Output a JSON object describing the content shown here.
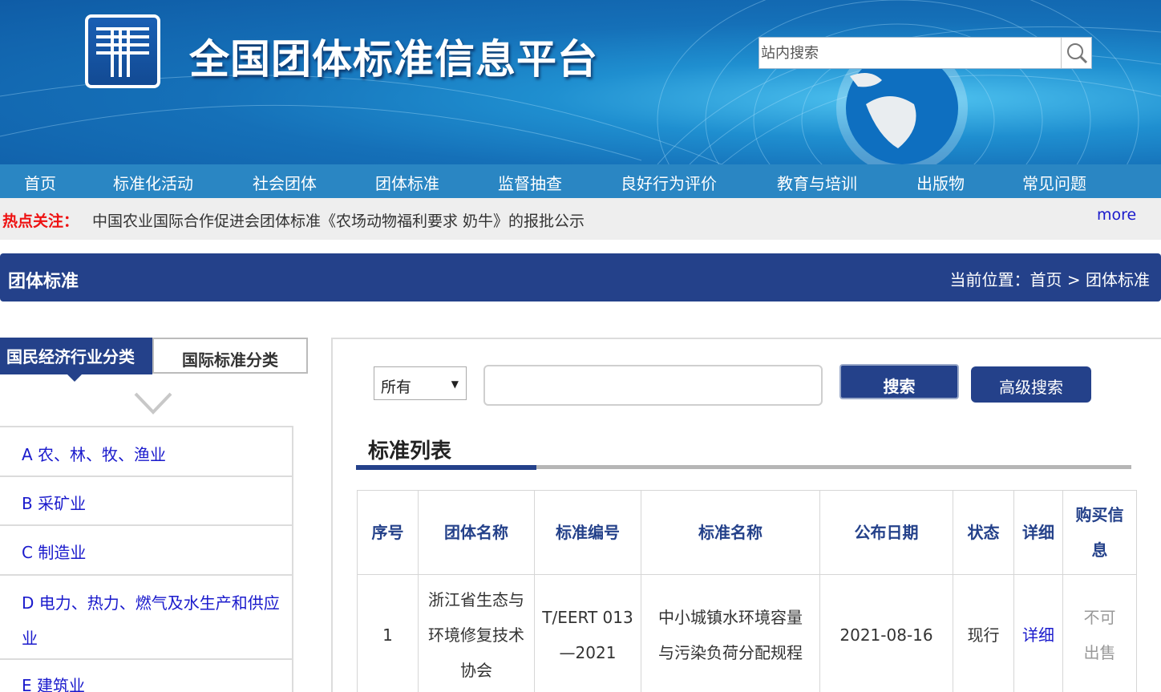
{
  "header": {
    "site_title": "全国团体标准信息平台",
    "search_placeholder": "站内搜索"
  },
  "nav": {
    "items": [
      "首页",
      "标准化活动",
      "社会团体",
      "团体标准",
      "监督抽查",
      "良好行为评价",
      "教育与培训",
      "出版物",
      "常见问题"
    ]
  },
  "hotbar": {
    "label": "热点关注：",
    "text": "中国农业国际合作促进会团体标准《农场动物福利要求 奶牛》的报批公示",
    "more": "more"
  },
  "section": {
    "title": "团体标准",
    "breadcrumb": "当前位置：首页 > 团体标准"
  },
  "left": {
    "tab_active": "国民经济行业分类",
    "tab_inactive": "国际标准分类",
    "categories": [
      "A 农、林、牧、渔业",
      "B 采矿业",
      "C 制造业",
      "D 电力、热力、燃气及水生产和供应业",
      "E 建筑业"
    ]
  },
  "search": {
    "select_value": "所有",
    "query_value": "",
    "search_button": "搜索",
    "advanced_button": "高级搜索"
  },
  "list": {
    "title": "标准列表",
    "headers": [
      "序号",
      "团体名称",
      "标准编号",
      "标准名称",
      "公布日期",
      "状态",
      "详细",
      "购买信息"
    ],
    "rows": [
      [
        "1",
        "浙江省生态与环境修复技术协会",
        "T/EERT 013—2021",
        "中小城镇水环境容量与污染负荷分配规程",
        "2021-08-16",
        "现行",
        "详细",
        "不可出售"
      ]
    ]
  },
  "colors": {
    "navy": "#24418a",
    "nav_blue": "#2a86c3",
    "link": "#1a1acc",
    "hot_red": "#ee1111"
  },
  "icons": [
    "logo-icon",
    "search-icon",
    "chevron-down-icon"
  ]
}
